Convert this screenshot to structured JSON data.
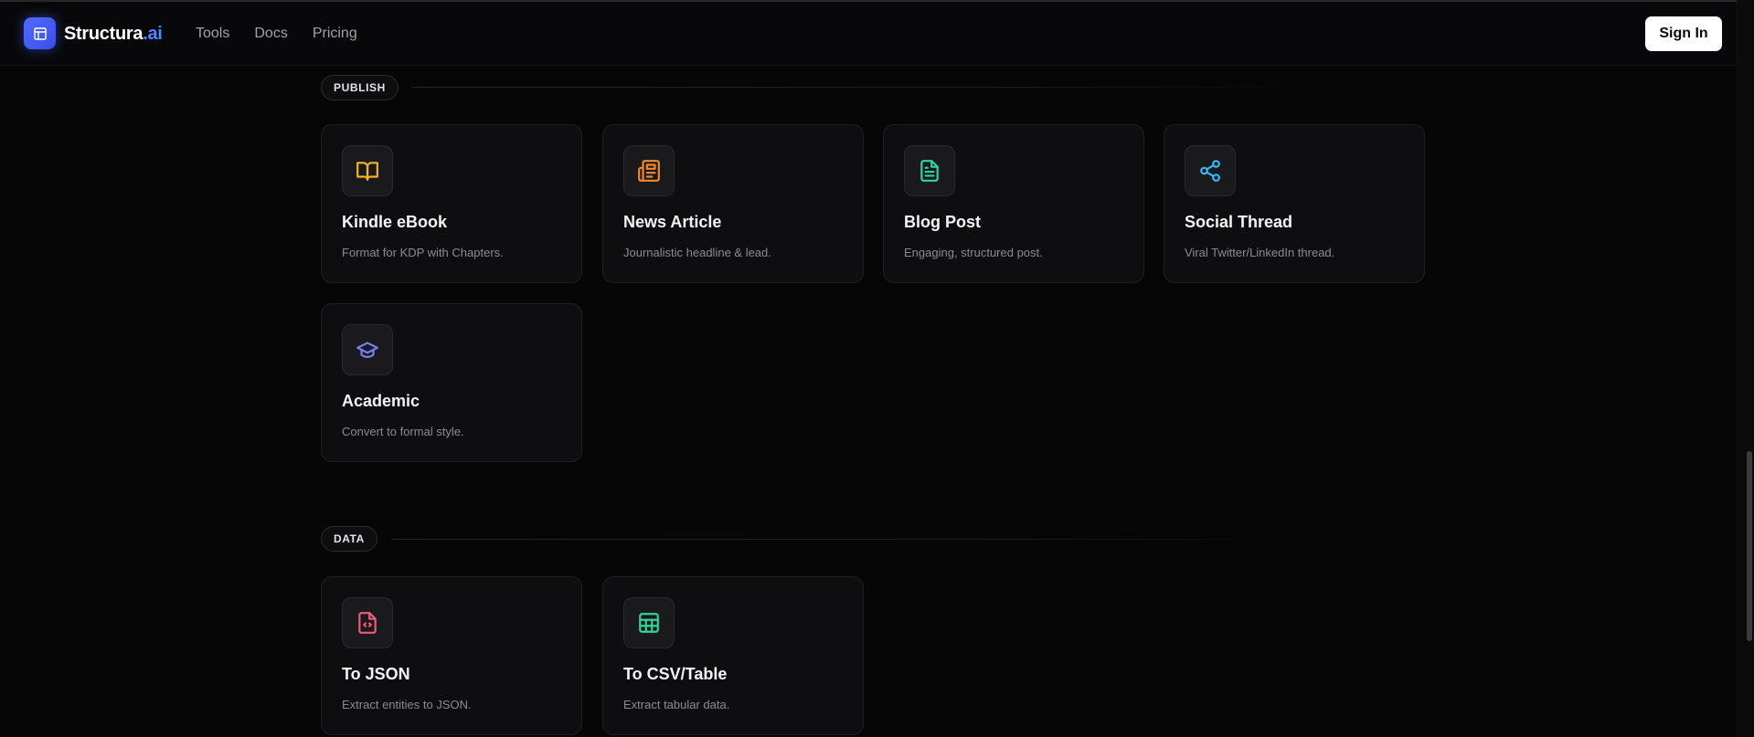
{
  "brand": {
    "name": "Structura",
    "suffix": ".ai"
  },
  "nav": {
    "items": [
      "Tools",
      "Docs",
      "Pricing"
    ]
  },
  "header": {
    "signin_label": "Sign In"
  },
  "sections": {
    "publish": {
      "label": "PUBLISH",
      "cards": [
        {
          "title": "Kindle eBook",
          "desc": "Format for KDP with Chapters.",
          "icon": "book-open-icon",
          "color": "#f5b32a"
        },
        {
          "title": "News Article",
          "desc": "Journalistic headline & lead.",
          "icon": "newspaper-icon",
          "color": "#f2892e"
        },
        {
          "title": "Blog Post",
          "desc": "Engaging, structured post.",
          "icon": "file-text-icon",
          "color": "#2fd3a7"
        },
        {
          "title": "Social Thread",
          "desc": "Viral Twitter/LinkedIn thread.",
          "icon": "share-icon",
          "color": "#38b6f5"
        },
        {
          "title": "Academic",
          "desc": "Convert to formal style.",
          "icon": "graduation-cap-icon",
          "color": "#7b7ff7"
        }
      ]
    },
    "data": {
      "label": "DATA",
      "cards": [
        {
          "title": "To JSON",
          "desc": "Extract entities to JSON.",
          "icon": "file-code-icon",
          "color": "#f25a7a"
        },
        {
          "title": "To CSV/Table",
          "desc": "Extract tabular data.",
          "icon": "table-icon",
          "color": "#34d399"
        }
      ]
    }
  }
}
